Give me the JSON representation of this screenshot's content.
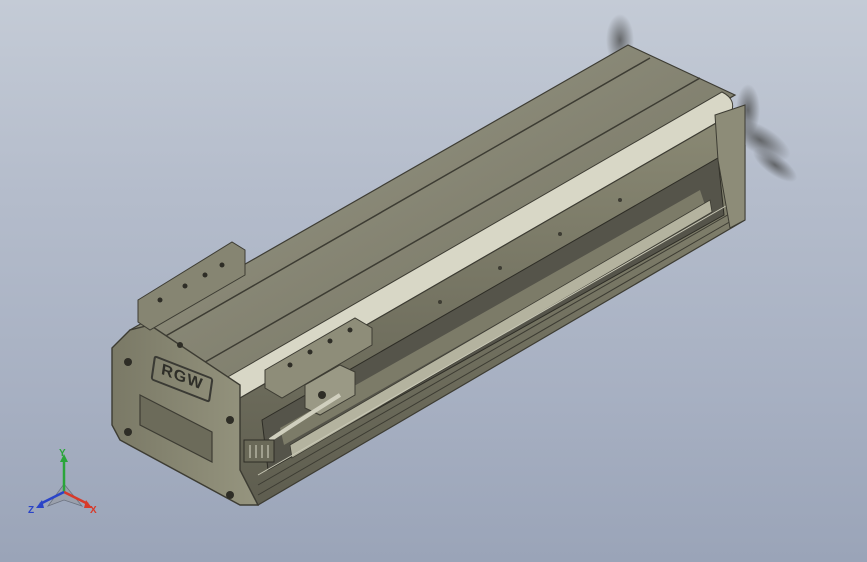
{
  "viewport": {
    "background_top": "#c4cbd6",
    "background_bottom": "#9aa4b8"
  },
  "model": {
    "part": "linear-actuator-module",
    "body_color": "#8f8e7a",
    "logo_text": "RGW"
  },
  "triad": {
    "x_label": "X",
    "y_label": "Y",
    "z_label": "Z",
    "x_color": "#d83a2a",
    "y_color": "#2aa53a",
    "z_color": "#2a44c8"
  }
}
